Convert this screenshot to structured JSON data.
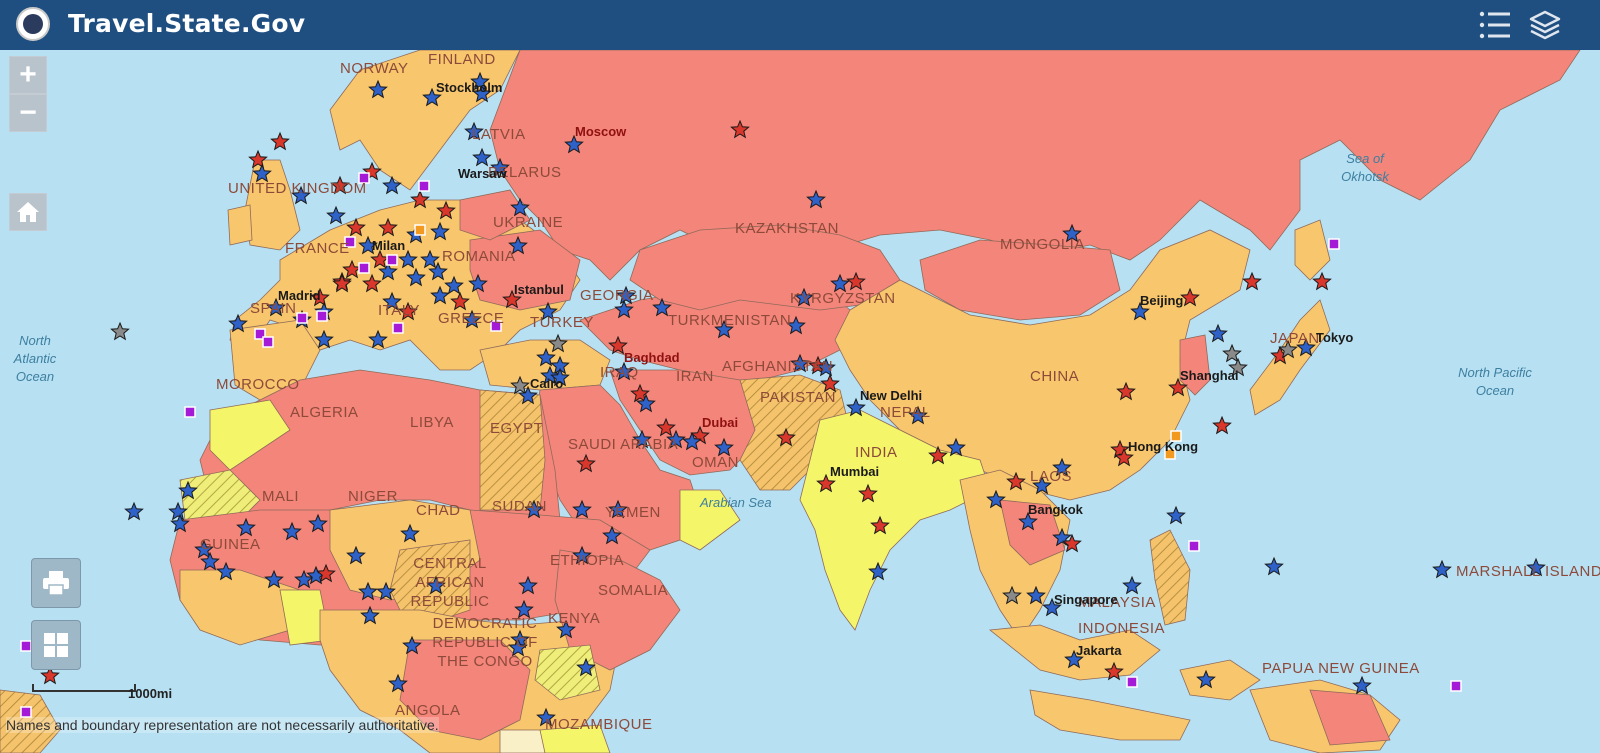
{
  "header": {
    "title": "Travel.State.Gov",
    "list_icon": "list-icon",
    "layers_icon": "layers-icon"
  },
  "controls": {
    "zoom_in": "+",
    "zoom_out": "−",
    "home_icon": "home-icon",
    "print_icon": "printer-icon",
    "basemap_icon": "grid-icon"
  },
  "scale": {
    "label": "1000mi"
  },
  "disclaimer": "Names and boundary representation are not necessarily authoritative.",
  "colors": {
    "level4_do_not_travel": "#f4857a",
    "level3_reconsider": "#f8c66c",
    "level2_caution": "#f5f56a",
    "level1_normal": "#faf0c8",
    "water": "#b7e1f3",
    "header": "#1f4f80"
  },
  "map": {
    "countries": [
      {
        "name": "NORWAY"
      },
      {
        "name": "FINLAND"
      },
      {
        "name": "LATVIA"
      },
      {
        "name": "BELARUS"
      },
      {
        "name": "UNITED KINGDOM"
      },
      {
        "name": "FRANCE"
      },
      {
        "name": "UKRAINE"
      },
      {
        "name": "ROMANIA"
      },
      {
        "name": "SPAIN"
      },
      {
        "name": "ITALY"
      },
      {
        "name": "GREECE"
      },
      {
        "name": "TURKEY"
      },
      {
        "name": "GEORGIA"
      },
      {
        "name": "TURKMENISTAN"
      },
      {
        "name": "KYRGYZSTAN"
      },
      {
        "name": "KAZAKHSTAN"
      },
      {
        "name": "MONGOLIA"
      },
      {
        "name": "CHINA"
      },
      {
        "name": "JAPAN"
      },
      {
        "name": "IRAQ"
      },
      {
        "name": "IRAN"
      },
      {
        "name": "AFGHANISTAN"
      },
      {
        "name": "PAKISTAN"
      },
      {
        "name": "NEPAL"
      },
      {
        "name": "INDIA"
      },
      {
        "name": "MOROCCO"
      },
      {
        "name": "ALGERIA"
      },
      {
        "name": "LIBYA"
      },
      {
        "name": "EGYPT"
      },
      {
        "name": "SAUDI ARABIA"
      },
      {
        "name": "OMAN"
      },
      {
        "name": "YEMEN"
      },
      {
        "name": "MALI"
      },
      {
        "name": "NIGER"
      },
      {
        "name": "CHAD"
      },
      {
        "name": "SUDAN"
      },
      {
        "name": "ETHIOPIA"
      },
      {
        "name": "SOMALIA"
      },
      {
        "name": "CENTRAL AFRICAN REPUBLIC"
      },
      {
        "name": "DEMOCRATIC REPUBLIC OF THE CONGO"
      },
      {
        "name": "KENYA"
      },
      {
        "name": "ANGOLA"
      },
      {
        "name": "MOZAMBIQUE"
      },
      {
        "name": "GUINEA"
      },
      {
        "name": "LAOS"
      },
      {
        "name": "MALAYSIA"
      },
      {
        "name": "INDONESIA"
      },
      {
        "name": "PAPUA NEW GUINEA"
      },
      {
        "name": "MARSHALL ISLANDS"
      }
    ],
    "cities": [
      {
        "name": "Stockholm"
      },
      {
        "name": "Moscow"
      },
      {
        "name": "Warsaw"
      },
      {
        "name": "Milan"
      },
      {
        "name": "Madrid"
      },
      {
        "name": "Istanbul"
      },
      {
        "name": "Cairo"
      },
      {
        "name": "Baghdad"
      },
      {
        "name": "Dubai"
      },
      {
        "name": "New Delhi"
      },
      {
        "name": "Mumbai"
      },
      {
        "name": "Beijing"
      },
      {
        "name": "Shanghai"
      },
      {
        "name": "Tokyo"
      },
      {
        "name": "Hong Kong"
      },
      {
        "name": "Bangkok"
      },
      {
        "name": "Singapore"
      },
      {
        "name": "Jakarta"
      }
    ],
    "oceans": [
      {
        "name": "North Atlantic Ocean"
      },
      {
        "name": "Sea of Okhotsk"
      },
      {
        "name": "North Pacific Ocean"
      },
      {
        "name": "Arabian Sea"
      }
    ]
  }
}
